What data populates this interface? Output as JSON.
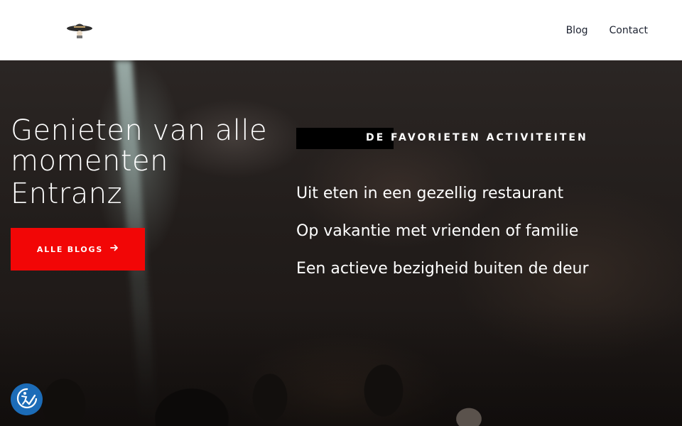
{
  "header": {
    "logo_icon": "sombrero-logo-icon",
    "nav": [
      {
        "label": "Blog"
      },
      {
        "label": "Contact"
      }
    ]
  },
  "hero": {
    "title_line1": "Genieten van alle",
    "title_line2": "momenten",
    "title_brand": "Entranz",
    "cta_label": "ALLE BLOGS",
    "cta_icon": "arrow-right-icon",
    "favorites_heading": "DE FAVORIETEN ACTIVITEITEN",
    "activities": [
      "Uit eten in een gezellig restaurant",
      "Op vakantie met vrienden of familie",
      "Een actieve bezigheid buiten de deur"
    ]
  },
  "accessibility": {
    "icon": "accessibility-check-icon",
    "color": "#1c6cb8"
  },
  "colors": {
    "accent": "#f20606",
    "header_bg": "#ffffff",
    "nav_text": "#1c2230"
  }
}
